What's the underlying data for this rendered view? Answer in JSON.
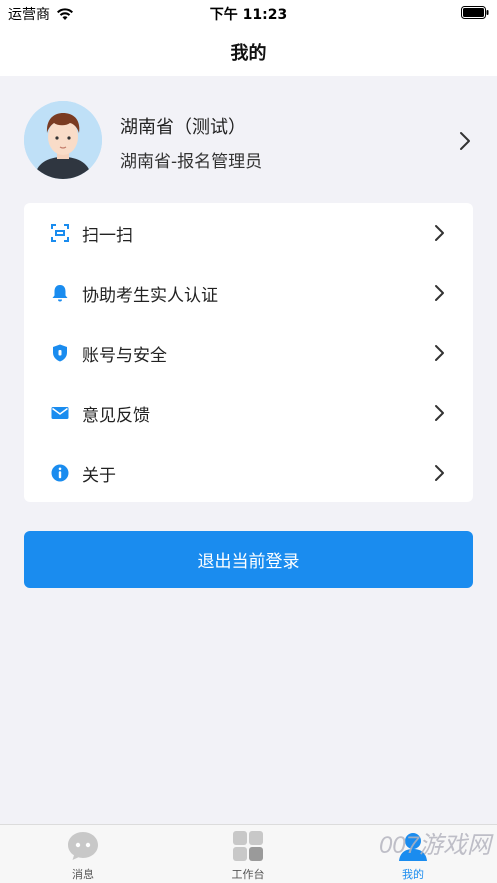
{
  "status_bar": {
    "carrier": "运营商",
    "time": "下午 11:23"
  },
  "nav": {
    "title": "我的"
  },
  "profile": {
    "name": "湖南省（测试）",
    "role": "湖南省-报名管理员"
  },
  "menu": {
    "items": [
      {
        "label": "扫一扫",
        "icon": "scan-icon"
      },
      {
        "label": "协助考生实人认证",
        "icon": "bell-icon"
      },
      {
        "label": "账号与安全",
        "icon": "shield-icon"
      },
      {
        "label": "意见反馈",
        "icon": "mail-icon"
      },
      {
        "label": "关于",
        "icon": "info-icon"
      }
    ]
  },
  "logout": {
    "label": "退出当前登录"
  },
  "tabs": [
    {
      "label": "消息",
      "icon": "message-icon",
      "active": false
    },
    {
      "label": "工作台",
      "icon": "grid-icon",
      "active": false
    },
    {
      "label": "我的",
      "icon": "profile-icon",
      "active": true
    }
  ],
  "watermark": "007游戏网",
  "colors": {
    "accent": "#1a8cef",
    "background": "#f2f2f7"
  }
}
